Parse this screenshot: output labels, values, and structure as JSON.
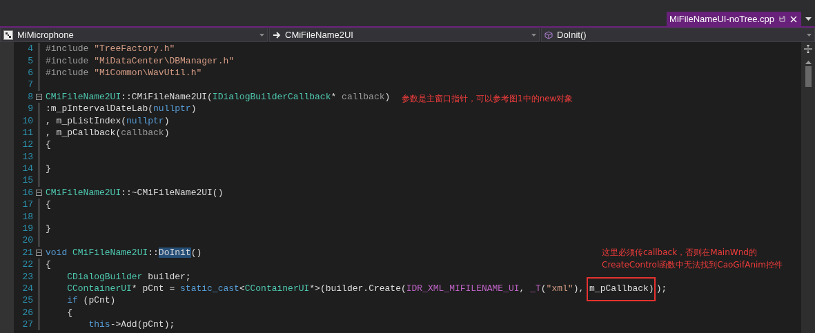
{
  "tab": {
    "title": "MiFileNameUI-noTree.cpp",
    "selected": true
  },
  "nav": [
    {
      "kind": "project",
      "label": "MiMicrophone"
    },
    {
      "kind": "class",
      "label": "CMiFileName2UI"
    },
    {
      "kind": "member",
      "label": "DoInit()"
    }
  ],
  "lines": [
    {
      "number": "4",
      "collapsible": false,
      "tokens": [
        {
          "kind": "preproc",
          "text": "#include "
        },
        {
          "kind": "string",
          "text": "\"TreeFactory.h\""
        }
      ]
    },
    {
      "number": "5",
      "collapsible": false,
      "tokens": [
        {
          "kind": "preproc",
          "text": "#include "
        },
        {
          "kind": "string",
          "text": "\"MiDataCenter\\DBManager.h\""
        }
      ]
    },
    {
      "number": "6",
      "collapsible": false,
      "tokens": [
        {
          "kind": "preproc",
          "text": "#include "
        },
        {
          "kind": "string",
          "text": "\"MiCommon\\WavUtil.h\""
        }
      ]
    },
    {
      "number": "7",
      "collapsible": false
    },
    {
      "number": "8",
      "collapsible": true,
      "tokens": [
        {
          "kind": "type",
          "text": "CMiFileName2UI"
        },
        {
          "kind": "plain",
          "text": "::CMiFileName2UI("
        },
        {
          "kind": "type",
          "text": "IDialogBuilderCallback"
        },
        {
          "kind": "plain",
          "text": "* "
        },
        {
          "kind": "param",
          "text": "callback"
        },
        {
          "kind": "plain",
          "text": ")"
        }
      ]
    },
    {
      "number": "9",
      "collapsible": false,
      "tokens": [
        {
          "kind": "plain",
          "text": ":m_pIntervalDateLab("
        },
        {
          "kind": "keyword",
          "text": "nullptr"
        },
        {
          "kind": "plain",
          "text": ")"
        }
      ]
    },
    {
      "number": "10",
      "collapsible": false,
      "tokens": [
        {
          "kind": "plain",
          "text": ", m_pListIndex("
        },
        {
          "kind": "keyword",
          "text": "nullptr"
        },
        {
          "kind": "plain",
          "text": ")"
        }
      ]
    },
    {
      "number": "11",
      "collapsible": false,
      "tokens": [
        {
          "kind": "plain",
          "text": ", m_pCallback("
        },
        {
          "kind": "param",
          "text": "callback"
        },
        {
          "kind": "plain",
          "text": ")"
        }
      ]
    },
    {
      "number": "12",
      "collapsible": false,
      "tokens": [
        {
          "kind": "plain",
          "text": "{"
        }
      ]
    },
    {
      "number": "13",
      "collapsible": false
    },
    {
      "number": "14",
      "collapsible": false,
      "tokens": [
        {
          "kind": "plain",
          "text": "}"
        }
      ]
    },
    {
      "number": "15",
      "collapsible": false
    },
    {
      "number": "16",
      "collapsible": true,
      "tokens": [
        {
          "kind": "type",
          "text": "CMiFileName2UI"
        },
        {
          "kind": "plain",
          "text": "::~CMiFileName2UI()"
        }
      ]
    },
    {
      "number": "17",
      "collapsible": false,
      "tokens": [
        {
          "kind": "plain",
          "text": "{"
        }
      ]
    },
    {
      "number": "18",
      "collapsible": false
    },
    {
      "number": "19",
      "collapsible": false,
      "tokens": [
        {
          "kind": "plain",
          "text": "}"
        }
      ]
    },
    {
      "number": "20",
      "collapsible": false
    },
    {
      "number": "21",
      "collapsible": true,
      "tokens": [
        {
          "kind": "keyword",
          "text": "void "
        },
        {
          "kind": "type",
          "text": "CMiFileName2UI"
        },
        {
          "kind": "plain",
          "text": "::"
        },
        {
          "kind": "plain",
          "text": "DoInit",
          "highlighted": true
        },
        {
          "kind": "plain",
          "text": "()"
        }
      ]
    },
    {
      "number": "22",
      "collapsible": false,
      "tokens": [
        {
          "kind": "plain",
          "text": "{"
        }
      ]
    },
    {
      "number": "23",
      "collapsible": false,
      "tokens": [
        {
          "kind": "type",
          "text": "    CDialogBuilder"
        },
        {
          "kind": "plain",
          "text": " builder;"
        }
      ]
    },
    {
      "number": "24",
      "collapsible": false,
      "tokens": [
        {
          "kind": "type",
          "text": "    CContainerUI"
        },
        {
          "kind": "plain",
          "text": "* pCnt = "
        },
        {
          "kind": "keyword",
          "text": "static_cast"
        },
        {
          "kind": "plain",
          "text": "<"
        },
        {
          "kind": "type",
          "text": "CContainerUI"
        },
        {
          "kind": "plain",
          "text": "*>(builder.Create("
        },
        {
          "kind": "macro",
          "text": "IDR_XML_MIFILENAME_UI"
        },
        {
          "kind": "plain",
          "text": ", "
        },
        {
          "kind": "macro",
          "text": "_T"
        },
        {
          "kind": "plain",
          "text": "("
        },
        {
          "kind": "string",
          "text": "\"xml\""
        },
        {
          "kind": "plain",
          "text": "), "
        },
        {
          "kind": "plain",
          "text": "m_pCallback)",
          "boxed": true
        },
        {
          "kind": "plain",
          "text": ");"
        }
      ]
    },
    {
      "number": "25",
      "collapsible": false,
      "tokens": [
        {
          "kind": "keyword",
          "text": "    if"
        },
        {
          "kind": "plain",
          "text": " (pCnt)"
        }
      ]
    },
    {
      "number": "26",
      "collapsible": false,
      "tokens": [
        {
          "kind": "plain",
          "text": "    {"
        }
      ]
    },
    {
      "number": "27",
      "collapsible": false,
      "tokens": [
        {
          "kind": "keyword",
          "text": "        this"
        },
        {
          "kind": "plain",
          "text": "->Add(pCnt);"
        }
      ]
    }
  ],
  "notes": [
    {
      "lines": [
        "参数是主窗口指针，可以参考图1中的new对象"
      ]
    },
    {
      "lines": [
        "这里必须传callback，否则在MainWnd的",
        "CreateControl函数中无法找到CaoGifAnim控件"
      ]
    }
  ]
}
